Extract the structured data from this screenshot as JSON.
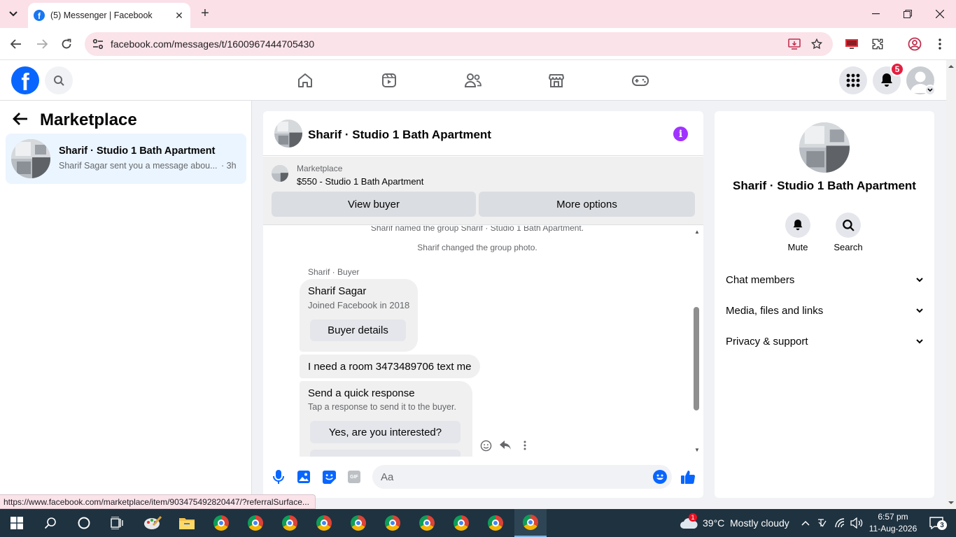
{
  "browser": {
    "tab_title": "(5) Messenger | Facebook",
    "tab_close": "✕",
    "new_tab": "+",
    "url": "facebook.com/messages/t/1600967444705430",
    "status_url": "https://www.facebook.com/marketplace/item/903475492820447/?referralSurface..."
  },
  "fb": {
    "notification_count": "5",
    "brand_color": "#0866ff"
  },
  "left": {
    "title": "Marketplace",
    "conversation": {
      "name": "Sharif · Studio 1 Bath Apartment",
      "snippet": "Sharif Sagar sent you a message abou...",
      "time": "· 3h"
    }
  },
  "chat": {
    "title": "Sharif · Studio 1 Bath Apartment",
    "marketplace_label": "Marketplace",
    "listing": "$550 - Studio 1 Bath Apartment",
    "view_buyer": "View buyer",
    "more_options": "More options",
    "system_messages": [
      "Sharif named the group Sharif · Studio 1 Bath Apartment.",
      "Sharif changed the group photo."
    ],
    "sender_label": "Sharif · Buyer",
    "buyer_card": {
      "name": "Sharif Sagar",
      "joined": "Joined Facebook in 2018",
      "button": "Buyer details"
    },
    "message_text": "I need a room 3473489706 text me",
    "quick_response": {
      "title": "Send a quick response",
      "subtitle": "Tap a response to send it to the buyer.",
      "option1": "Yes, are you interested?"
    },
    "composer_placeholder": "Aa",
    "gif_label": "GIF"
  },
  "right": {
    "name": "Sharif · Studio 1 Bath Apartment",
    "mute": "Mute",
    "search": "Search",
    "sections": [
      "Chat members",
      "Media, files and links",
      "Privacy & support"
    ]
  },
  "taskbar": {
    "weather_badge": "1",
    "weather": "39°C",
    "weather_desc": "Mostly cloudy",
    "time": "6:57 pm",
    "date": "11-Aug-2026",
    "notif_count": "3"
  }
}
